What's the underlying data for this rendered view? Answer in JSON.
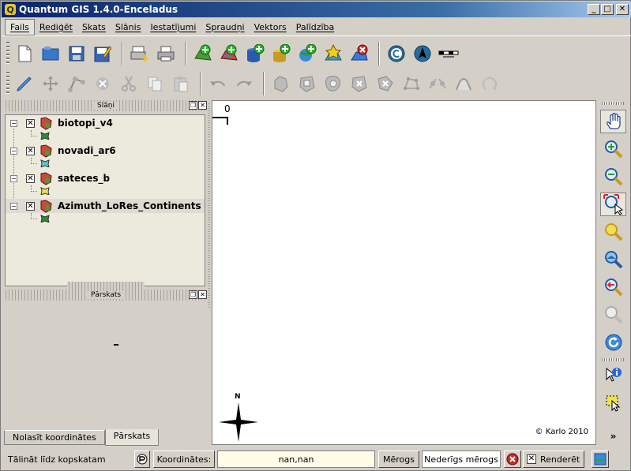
{
  "window": {
    "title": "Quantum GIS 1.4.0-Enceladus",
    "app_icon_letter": "Q"
  },
  "menus": [
    "Fails",
    "Rediģēt",
    "Skats",
    "Slānis",
    "Iestatījumi",
    "Spraudņi",
    "Vektors",
    "Palīdzība"
  ],
  "toolbar1_icons": [
    "new-project-icon",
    "open-project-icon",
    "save-project-icon",
    "save-as-icon",
    "new-print-composer-icon",
    "print-icon",
    "add-vector-layer-icon",
    "add-raster-layer-icon",
    "add-postgis-layer-icon",
    "add-spatialite-layer-icon",
    "add-wms-layer-icon",
    "new-vector-layer-icon",
    "remove-layer-icon",
    "copyright-label-icon",
    "north-arrow-icon",
    "scale-bar-icon"
  ],
  "toolbar2_icons": [
    "toggle-editing-icon",
    "move-feature-icon",
    "node-tool-icon",
    "delete-selected-icon",
    "cut-features-icon",
    "copy-features-icon",
    "paste-features-icon",
    "undo-icon",
    "redo-icon",
    "simplify-feature-icon",
    "add-ring-icon",
    "add-island-icon",
    "delete-ring-icon",
    "delete-part-icon",
    "reshape-features-icon",
    "split-features-icon",
    "merge-features-icon",
    "rotate-label-icon"
  ],
  "layers_panel": {
    "title": "Slāņi",
    "layers": [
      {
        "name": "biotopi_v4",
        "checked": true,
        "symbol_color": "#2e8b3a"
      },
      {
        "name": "novadi_ar6",
        "checked": true,
        "symbol_color": "#5ac8d8"
      },
      {
        "name": "sateces_b",
        "checked": true,
        "symbol_color": "#f2e44a"
      },
      {
        "name": "Azimuth_LoRes_Continents",
        "checked": true,
        "symbol_color": "#2e8b3a"
      }
    ]
  },
  "overview_panel": {
    "title": "Pārskats"
  },
  "tabs": [
    "Nolasīt koordinātes",
    "Pārskats"
  ],
  "canvas": {
    "scale_label": "0",
    "north_label": "N",
    "copyright": "© Karlo 2010"
  },
  "map_tools": [
    "pan-icon",
    "zoom-in-icon",
    "zoom-out-icon",
    "zoom-full-icon",
    "zoom-to-selection-icon",
    "zoom-to-layer-icon",
    "zoom-last-icon",
    "zoom-actual-icon",
    "refresh-icon",
    "identify-icon",
    "select-features-icon",
    "more-tools-icon"
  ],
  "status": {
    "progress_text": "Tālināt līdz kopskatam",
    "coords_label": "Koordinātes:",
    "coords_value": "nan,nan",
    "scale_label": "Mērogs",
    "scale_value": "Nederīgs mērogs",
    "render_label": "Renderēt",
    "render_checked": true
  }
}
